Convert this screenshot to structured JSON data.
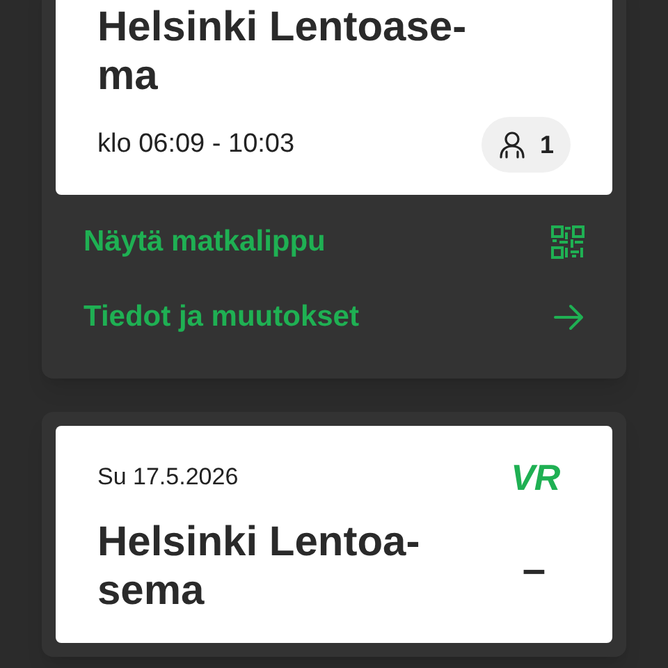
{
  "trips": [
    {
      "title_lines": [
        "Helsinki Lentoase-",
        "ma"
      ],
      "time": "klo 06:09 - 10:03",
      "passengers": "1",
      "actions": [
        {
          "label": "Näytä matkalippu",
          "kind": "qr"
        },
        {
          "label": "Tiedot ja muutokset",
          "kind": "arrow"
        }
      ]
    },
    {
      "date": "Su 17.5.2026",
      "logo": "VR",
      "title_lines": [
        "Helsinki Lentoa-",
        "sema"
      ],
      "dash": "–"
    }
  ]
}
